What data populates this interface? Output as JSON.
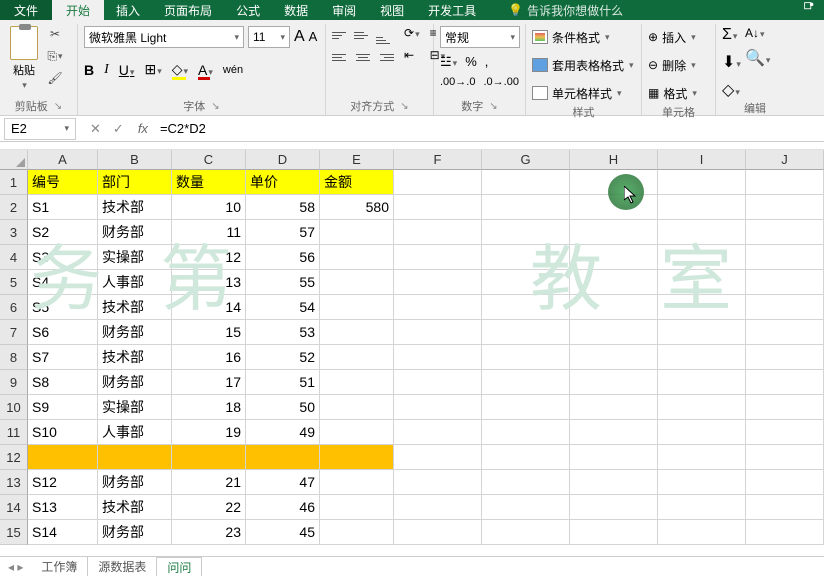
{
  "tabs": {
    "file": "文件",
    "home": "开始",
    "insert": "插入",
    "layout": "页面布局",
    "formulas": "公式",
    "data": "数据",
    "review": "审阅",
    "view": "视图",
    "dev": "开发工具",
    "tellme": "告诉我你想做什么"
  },
  "ribbon": {
    "clipboard": {
      "paste": "粘贴",
      "label": "剪贴板"
    },
    "font": {
      "family": "微软雅黑 Light",
      "size": "11",
      "label": "字体",
      "wen": "wén"
    },
    "align": {
      "label": "对齐方式"
    },
    "number": {
      "general": "常规",
      "label": "数字"
    },
    "styles": {
      "cond": "条件格式",
      "table": "套用表格格式",
      "cell": "单元格样式",
      "label": "样式"
    },
    "cells": {
      "insert": "插入",
      "delete": "删除",
      "format": "格式",
      "label": "单元格"
    },
    "editing": {
      "label": "编辑"
    }
  },
  "fx": {
    "name": "E2",
    "formula": "=C2*D2"
  },
  "cols": [
    "A",
    "B",
    "C",
    "D",
    "E",
    "F",
    "G",
    "H",
    "I",
    "J"
  ],
  "headers": {
    "A": "编号",
    "B": "部门",
    "C": "数量",
    "D": "单价",
    "E": "金额"
  },
  "rows": [
    {
      "n": "2",
      "A": "S1",
      "B": "技术部",
      "C": "10",
      "D": "58",
      "E": "580"
    },
    {
      "n": "3",
      "A": "S2",
      "B": "财务部",
      "C": "11",
      "D": "57",
      "E": ""
    },
    {
      "n": "4",
      "A": "S3",
      "B": "实操部",
      "C": "12",
      "D": "56",
      "E": ""
    },
    {
      "n": "5",
      "A": "S4",
      "B": "人事部",
      "C": "13",
      "D": "55",
      "E": ""
    },
    {
      "n": "6",
      "A": "S5",
      "B": "技术部",
      "C": "14",
      "D": "54",
      "E": ""
    },
    {
      "n": "7",
      "A": "S6",
      "B": "财务部",
      "C": "15",
      "D": "53",
      "E": ""
    },
    {
      "n": "8",
      "A": "S7",
      "B": "技术部",
      "C": "16",
      "D": "52",
      "E": ""
    },
    {
      "n": "9",
      "A": "S8",
      "B": "财务部",
      "C": "17",
      "D": "51",
      "E": ""
    },
    {
      "n": "10",
      "A": "S9",
      "B": "实操部",
      "C": "18",
      "D": "50",
      "E": ""
    },
    {
      "n": "11",
      "A": "S10",
      "B": "人事部",
      "C": "19",
      "D": "49",
      "E": ""
    },
    {
      "n": "12",
      "A": "",
      "B": "",
      "C": "",
      "D": "",
      "E": "",
      "orange": true
    },
    {
      "n": "13",
      "A": "S12",
      "B": "财务部",
      "C": "21",
      "D": "47",
      "E": ""
    },
    {
      "n": "14",
      "A": "S13",
      "B": "技术部",
      "C": "22",
      "D": "46",
      "E": ""
    },
    {
      "n": "15",
      "A": "S14",
      "B": "财务部",
      "C": "23",
      "D": "45",
      "E": ""
    }
  ],
  "sheet_tabs": {
    "t1": "工作簿",
    "t2": "源数据表",
    "t3": "问问"
  }
}
